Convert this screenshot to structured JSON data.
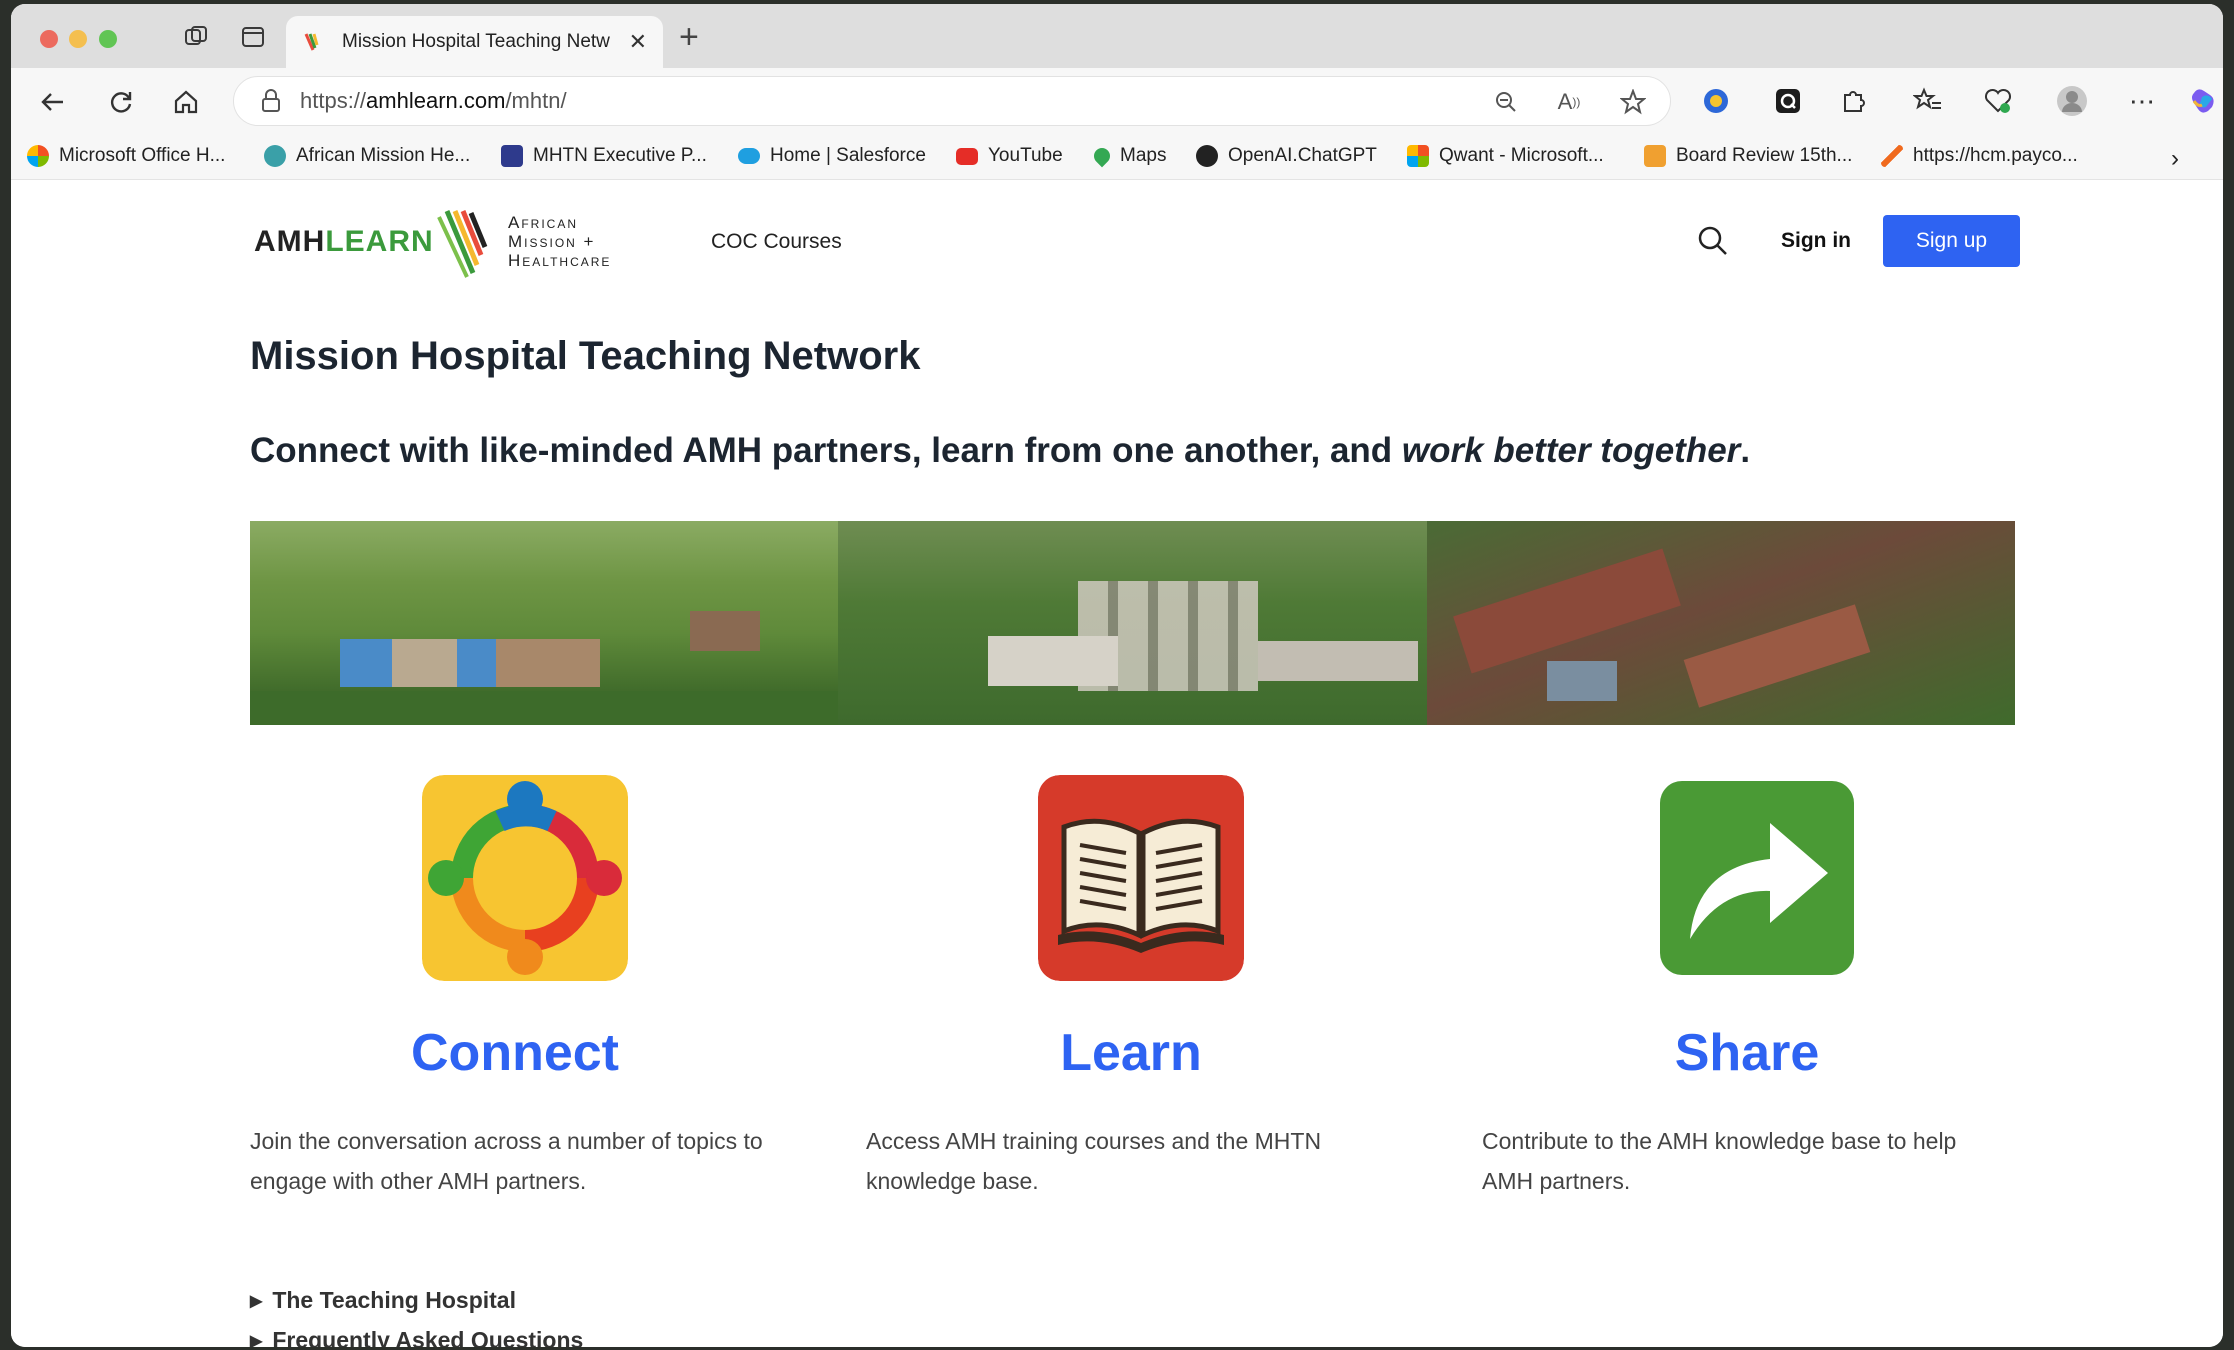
{
  "browser": {
    "tab_title": "Mission Hospital Teaching Netw",
    "url_prefix": "https://",
    "url_host": "amhlearn.com",
    "url_path": "/mhtn/",
    "bookmarks": [
      {
        "label": "Microsoft Office H...",
        "color": "#d9534f"
      },
      {
        "label": "African Mission He...",
        "color": "#3aa0a8"
      },
      {
        "label": "MHTN Executive P...",
        "color": "#2e3a8c"
      },
      {
        "label": "Home | Salesforce",
        "color": "#1f9fe0"
      },
      {
        "label": "YouTube",
        "color": "#e52d27"
      },
      {
        "label": "Maps",
        "color": "#34a853"
      },
      {
        "label": "OpenAI.ChatGPT",
        "color": "#222222"
      },
      {
        "label": "Qwant - Microsoft...",
        "color": "#f25022"
      },
      {
        "label": "Board Review 15th...",
        "color": "#f0a030"
      },
      {
        "label": "https://hcm.payco...",
        "color": "#f06a1e"
      }
    ]
  },
  "site": {
    "logo_amh": "AMH",
    "logo_learn": "LEARN",
    "logo_line1": "African",
    "logo_line2": "Mission +",
    "logo_line3": "Healthcare",
    "nav_coc": "COC Courses",
    "signin": "Sign in",
    "signup": "Sign up"
  },
  "main": {
    "title": "Mission Hospital Teaching Network",
    "tagline_plain": "Connect with like-minded AMH partners, learn from one another, and ",
    "tagline_italic": "work better together",
    "tagline_end": ".",
    "features": [
      {
        "title": "Connect",
        "desc": "Join the conversation across a number of topics to engage with other AMH partners.",
        "icon": "people-circle-icon"
      },
      {
        "title": "Learn",
        "desc": "Access AMH training courses and the MHTN knowledge base.",
        "icon": "open-book-icon"
      },
      {
        "title": "Share",
        "desc": "Contribute to the AMH knowledge base to help AMH partners.",
        "icon": "share-arrow-icon"
      }
    ],
    "details": [
      "The Teaching Hospital",
      "Frequently Asked Questions"
    ]
  },
  "colors": {
    "accent": "#2e63f2",
    "logo_green": "#3b9a3c",
    "learn_icon_bg": "#d63a2a",
    "connect_icon_bg": "#f7c531",
    "share_icon_bg": "#4a9a35"
  }
}
